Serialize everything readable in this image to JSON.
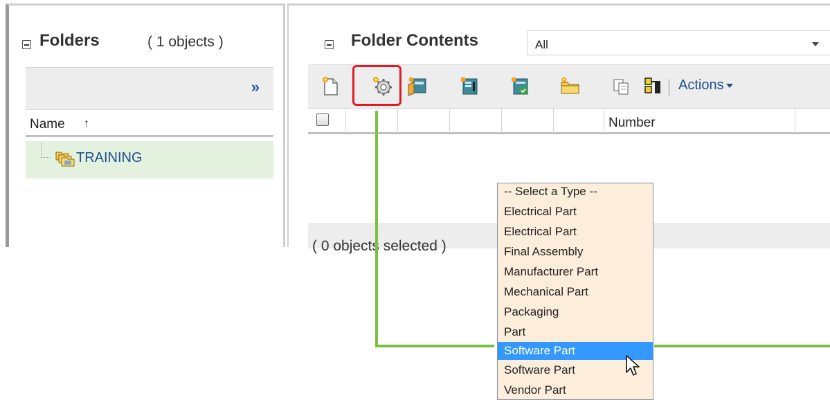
{
  "folders_panel": {
    "title": "Folders",
    "count_text": "( 1 objects )",
    "expand_label": "»",
    "column_name": "Name",
    "sort_indicator": "↑",
    "tree_items": [
      {
        "label": "TRAINING"
      }
    ]
  },
  "folder_contents": {
    "title": "Folder Contents",
    "filter_value": "All",
    "toolbar": {
      "icons": [
        "new-part-icon",
        "new-part-from-type-icon",
        "new-document-icon",
        "new-document-template-icon",
        "check-in-icon",
        "new-folder-icon",
        "copy-icon",
        "bom-icon"
      ],
      "actions_label": "Actions"
    },
    "columns": [
      "",
      "",
      "",
      "",
      "",
      "",
      "Number"
    ],
    "footer_text": "( 0 objects selected )"
  },
  "type_dropdown": {
    "options": [
      "-- Select a Type --",
      "Electrical Part",
      "Electrical Part",
      "Final Assembly",
      "Manufacturer Part",
      "Mechanical Part",
      "Packaging",
      "Part",
      "Software Part",
      "Software Part",
      "Vendor Part"
    ],
    "selected_index": 8
  },
  "colors": {
    "highlight": "#e01b24",
    "connector": "#7ac143",
    "selection": "#3399ff",
    "dropdown_bg": "#fdeedb",
    "tree_selection": "#e4f1df",
    "link": "#1d4f8c"
  }
}
